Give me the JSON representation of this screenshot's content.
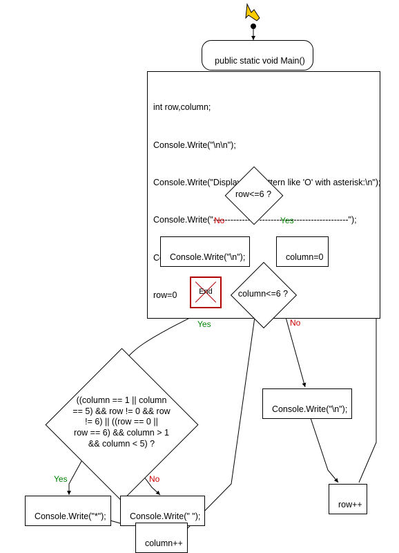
{
  "terminator": {
    "label": "public static void Main()"
  },
  "init_block": {
    "lines": [
      "int row,column;",
      "Console.Write(\"\\n\\n\");",
      "Console.Write(\"Display the pattern like 'O' with asterisk:\\n\");",
      "Console.Write(\"-----------------------------------------------\");",
      "Console.Write(\"\\n\\n\");",
      "row=0"
    ]
  },
  "decision_row": {
    "label": "row<=6 ?",
    "yes": "Yes",
    "no": "No"
  },
  "decision_col": {
    "label": "column<=6 ?",
    "yes": "Yes",
    "no": "No"
  },
  "decision_pattern": {
    "label": "((column == 1 || column\n== 5) && row != 0 && row\n!= 6) || ((row == 0 ||\nrow == 6) && column > 1\n&& column < 5) ?",
    "yes": "Yes",
    "no": "No"
  },
  "stmt_newline_left": "Console.Write(\"\\n\");",
  "stmt_column0": "column=0",
  "stmt_newline_right": "Console.Write(\"\\n\");",
  "stmt_star": "Console.Write(\"*\");",
  "stmt_space": "Console.Write(\" \");",
  "stmt_colpp": "column++",
  "stmt_rowpp": "row++",
  "end": {
    "label": "End"
  },
  "chart_data": {
    "type": "flowchart",
    "nodes": [
      {
        "id": "start",
        "kind": "start"
      },
      {
        "id": "main",
        "kind": "terminator",
        "label": "public static void Main()"
      },
      {
        "id": "init",
        "kind": "process",
        "label": "int row,column;\nConsole.Write(\"\\n\\n\");\nConsole.Write(\"Display the pattern like 'O' with asterisk:\\n\");\nConsole.Write(\"-----------------------------------------------\");\nConsole.Write(\"\\n\\n\");\nrow=0"
      },
      {
        "id": "d_row",
        "kind": "decision",
        "label": "row<=6 ?"
      },
      {
        "id": "nl_left",
        "kind": "process",
        "label": "Console.Write(\"\\n\");"
      },
      {
        "id": "col0",
        "kind": "process",
        "label": "column=0"
      },
      {
        "id": "end",
        "kind": "end",
        "label": "End"
      },
      {
        "id": "d_col",
        "kind": "decision",
        "label": "column<=6 ?"
      },
      {
        "id": "d_pat",
        "kind": "decision",
        "label": "((column == 1 || column == 5) && row != 0 && row != 6) || ((row == 0 || row == 6) && column > 1 && column < 5) ?"
      },
      {
        "id": "nl_right",
        "kind": "process",
        "label": "Console.Write(\"\\n\");"
      },
      {
        "id": "star",
        "kind": "process",
        "label": "Console.Write(\"*\");"
      },
      {
        "id": "space",
        "kind": "process",
        "label": "Console.Write(\" \");"
      },
      {
        "id": "colpp",
        "kind": "process",
        "label": "column++"
      },
      {
        "id": "rowpp",
        "kind": "process",
        "label": "row++"
      }
    ],
    "edges": [
      {
        "from": "start",
        "to": "main"
      },
      {
        "from": "main",
        "to": "init"
      },
      {
        "from": "init",
        "to": "d_row"
      },
      {
        "from": "d_row",
        "to": "nl_left",
        "label": "No"
      },
      {
        "from": "d_row",
        "to": "col0",
        "label": "Yes"
      },
      {
        "from": "nl_left",
        "to": "end"
      },
      {
        "from": "col0",
        "to": "d_col"
      },
      {
        "from": "d_col",
        "to": "d_pat",
        "label": "Yes"
      },
      {
        "from": "d_col",
        "to": "nl_right",
        "label": "No"
      },
      {
        "from": "nl_right",
        "to": "rowpp"
      },
      {
        "from": "rowpp",
        "to": "d_row"
      },
      {
        "from": "d_pat",
        "to": "star",
        "label": "Yes"
      },
      {
        "from": "d_pat",
        "to": "space",
        "label": "No"
      },
      {
        "from": "star",
        "to": "colpp"
      },
      {
        "from": "space",
        "to": "colpp"
      },
      {
        "from": "colpp",
        "to": "d_col"
      }
    ]
  }
}
